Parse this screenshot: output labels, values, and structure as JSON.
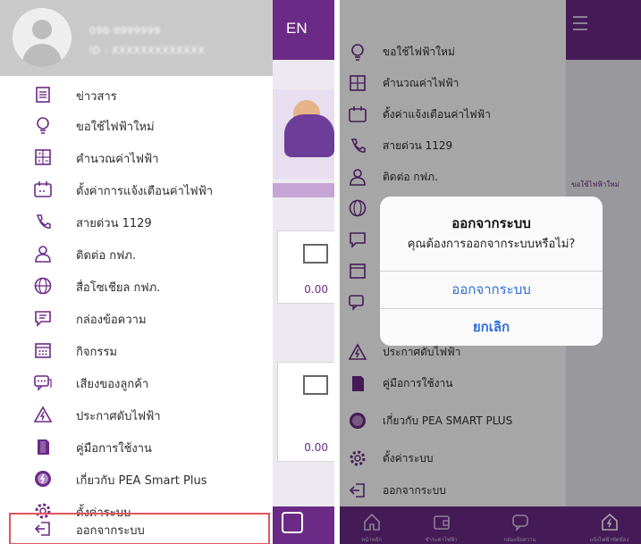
{
  "left": {
    "header": {
      "phone": "098-9999999",
      "id_text": "ID : XXXXXXXXXXXXX"
    },
    "language": "EN",
    "menu": [
      {
        "label": "ข่าวสาร",
        "icon": "news-icon"
      },
      {
        "label": "ขอใช้ไฟฟ้าใหม่",
        "icon": "lightbulb-icon"
      },
      {
        "label": "คำนวณค่าไฟฟ้า",
        "icon": "calculator-icon"
      },
      {
        "label": "ตั้งค่าการแจ้งเตือนค่าไฟฟ้า",
        "icon": "bill-alert-icon"
      },
      {
        "label": "สายด่วน 1129",
        "icon": "phone-icon"
      },
      {
        "label": "ติดต่อ กฟภ.",
        "icon": "contact-person-icon"
      },
      {
        "label": "สื่อโซเชียล กฟภ.",
        "icon": "globe-icon"
      },
      {
        "label": "กล่องข้อความ",
        "icon": "message-box-icon"
      },
      {
        "label": "กิจกรรม",
        "icon": "calendar-icon"
      },
      {
        "label": "เสียงของลูกค้า",
        "icon": "chat-bubble-icon"
      },
      {
        "label": "ประกาศดับไฟฟ้า",
        "icon": "warning-icon"
      },
      {
        "label": "คู่มือการใช้งาน",
        "icon": "manual-icon"
      },
      {
        "label": "เกี่ยวกับ PEA Smart Plus",
        "icon": "about-pea-icon"
      },
      {
        "label": "ตั้งค่าระบบ",
        "icon": "gear-icon"
      },
      {
        "label": "ออกจากระบบ",
        "icon": "logout-icon",
        "highlighted": true
      }
    ],
    "background": {
      "card_amounts": [
        "0.00",
        "0.00"
      ]
    }
  },
  "right": {
    "menu": [
      {
        "label": "ขอใช้ไฟฟ้าใหม่",
        "icon": "lightbulb-icon"
      },
      {
        "label": "คำนวณค่าไฟฟ้า",
        "icon": "calculator-icon"
      },
      {
        "label": "ตั้งค่าแจ้งเตือนค่าไฟฟ้า",
        "icon": "bill-alert-icon"
      },
      {
        "label": "สายด่วน 1129",
        "icon": "phone-icon"
      },
      {
        "label": "ติดต่อ กฟภ.",
        "icon": "contact-person-icon"
      },
      {
        "label": "",
        "icon": "globe-icon"
      },
      {
        "label": "",
        "icon": "message-box-icon"
      },
      {
        "label": "",
        "icon": "calendar-icon"
      },
      {
        "label": "",
        "icon": "chat-bubble-icon"
      },
      {
        "label": "ประกาศดับไฟฟ้า",
        "icon": "warning-icon"
      },
      {
        "label": "คู่มือการใช้งาน",
        "icon": "manual-icon"
      },
      {
        "label": "เกี่ยวกับ PEA SMART PLUS",
        "icon": "about-pea-icon"
      },
      {
        "label": "ตั้งค่าระบบ",
        "icon": "gear-icon"
      },
      {
        "label": "ออกจากระบบ",
        "icon": "logout-icon"
      }
    ],
    "peek_text": "ขอใช้ไฟฟ้าใหม่",
    "dialog": {
      "title": "ออกจากระบบ",
      "message": "คุณต้องการออกจากระบบหรือไม่?",
      "confirm": "ออกจากระบบ",
      "cancel": "ยกเลิก"
    },
    "tabs": [
      {
        "label": "หน้าหลัก",
        "icon": "home-icon"
      },
      {
        "label": "ชำระค่าไฟฟ้า",
        "icon": "wallet-icon"
      },
      {
        "label": "กล่องข้อความ",
        "icon": "message-box-icon"
      },
      {
        "label": "แจ้งไฟฟ้าขัดข้อง",
        "icon": "report-outage-icon"
      }
    ]
  },
  "colors": {
    "brand_purple": "#6b2a86",
    "highlight_red": "#e2545c",
    "dialog_blue": "#2f6fd9"
  }
}
